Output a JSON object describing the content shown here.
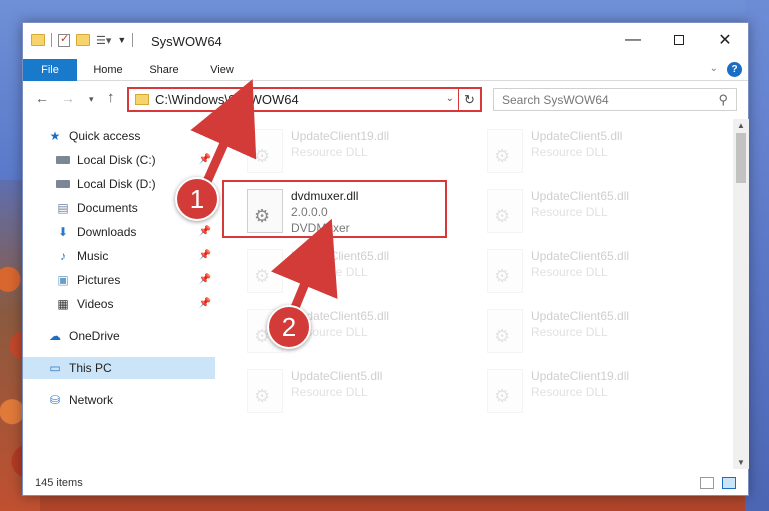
{
  "window": {
    "title": "SysWOW64",
    "controls": {
      "minimize": "—",
      "close": "✕"
    }
  },
  "ribbon": {
    "tabs": [
      "File",
      "Home",
      "Share",
      "View"
    ],
    "help": "?"
  },
  "navigation": {
    "address": "C:\\Windows\\SysWOW64",
    "search_placeholder": "Search SysWOW64"
  },
  "sidebar": {
    "items": [
      {
        "label": "Quick access",
        "icon": "star-icon"
      },
      {
        "label": "Local Disk (C:)",
        "icon": "disk-icon",
        "pinned": true
      },
      {
        "label": "Local Disk (D:)",
        "icon": "disk-icon",
        "pinned": true
      },
      {
        "label": "Documents",
        "icon": "documents-icon",
        "pinned": true
      },
      {
        "label": "Downloads",
        "icon": "downloads-icon",
        "pinned": true
      },
      {
        "label": "Music",
        "icon": "music-icon",
        "pinned": true
      },
      {
        "label": "Pictures",
        "icon": "pictures-icon",
        "pinned": true
      },
      {
        "label": "Videos",
        "icon": "videos-icon",
        "pinned": true
      },
      {
        "label": "OneDrive",
        "icon": "onedrive-icon"
      },
      {
        "label": "This PC",
        "icon": "this-pc-icon",
        "selected": true
      },
      {
        "label": "Network",
        "icon": "network-icon"
      }
    ]
  },
  "files": [
    {
      "name": "UpdateClient19.dll",
      "type": "Resource DLL",
      "faded": true
    },
    {
      "name": "UpdateClient5.dll",
      "type": "Resource DLL",
      "faded": true
    },
    {
      "name": "dvdmuxer.dll",
      "version": "2.0.0.0",
      "description": "DVDMuxer",
      "faded": false
    },
    {
      "name": "UpdateClient65.dll",
      "type": "Resource DLL",
      "faded": true
    },
    {
      "name": "UpdateClient65.dll",
      "type": "Resource DLL",
      "faded": true
    },
    {
      "name": "UpdateClient65.dll",
      "type": "Resource DLL",
      "faded": true
    },
    {
      "name": "UpdateClient65.dll",
      "type": "Resource DLL",
      "faded": true
    },
    {
      "name": "UpdateClient65.dll",
      "type": "Resource DLL",
      "faded": true
    },
    {
      "name": "UpdateClient5.dll",
      "type": "Resource DLL",
      "faded": true
    },
    {
      "name": "UpdateClient19.dll",
      "type": "Resource DLL",
      "faded": true
    }
  ],
  "status": {
    "item_count": "145 items"
  },
  "annotations": {
    "step1": "1",
    "step2": "2",
    "color": "#d9383a"
  }
}
